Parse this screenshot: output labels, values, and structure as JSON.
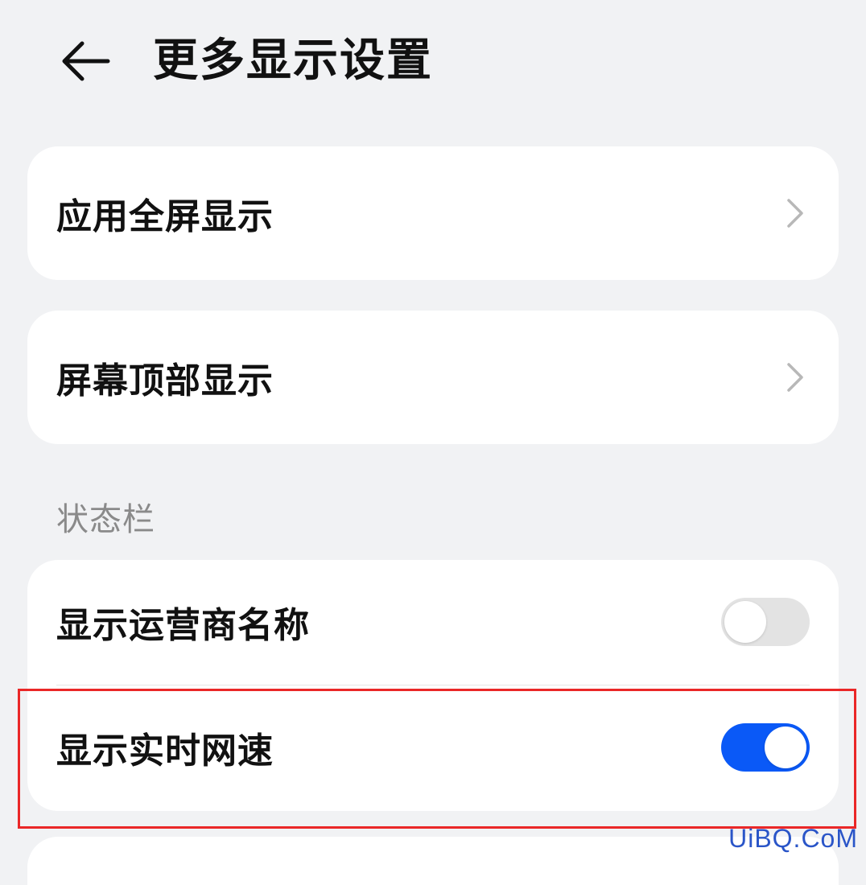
{
  "header": {
    "title": "更多显示设置",
    "back_icon": "arrow-left-icon"
  },
  "cards": [
    {
      "label": "应用全屏显示",
      "icon": "chevron-right-icon"
    },
    {
      "label": "屏幕顶部显示",
      "icon": "chevron-right-icon"
    }
  ],
  "status_bar_section": {
    "label": "状态栏",
    "items": [
      {
        "label": "显示运营商名称",
        "enabled": false
      },
      {
        "label": "显示实时网速",
        "enabled": true
      }
    ]
  },
  "colors": {
    "accent": "#0a59f7",
    "highlight": "#ea2727",
    "background": "#f1f2f4"
  },
  "watermark": "UiBQ.CoM"
}
